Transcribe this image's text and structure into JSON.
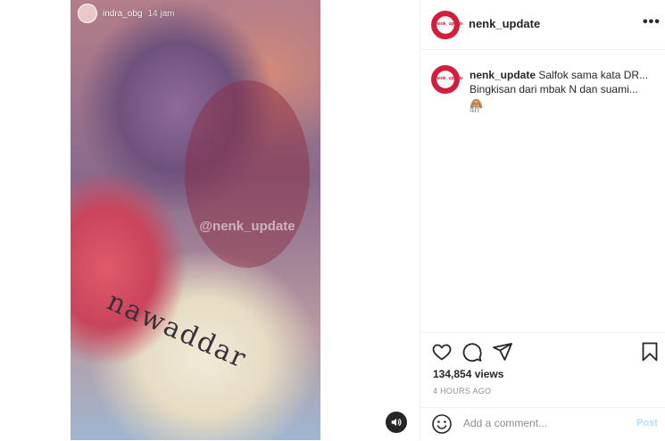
{
  "story": {
    "username": "indra_obg",
    "time": "14 jam",
    "watermark": "@nenk_update",
    "fruit_writing": "nawaddar"
  },
  "post": {
    "username": "nenk_update",
    "avatar_label": "nenk_update",
    "more_icon": "•••"
  },
  "caption": {
    "username": "nenk_update",
    "line1": "Salfok sama kata DR...",
    "line2": "Bingkisan dari mbak N dan suami... 🙈",
    "time": "4h"
  },
  "actions": {
    "views": "134,854 views",
    "posted": "4 HOURS AGO"
  },
  "comment": {
    "placeholder": "Add a comment...",
    "post_label": "Post"
  },
  "icons": {
    "like": "heart-icon",
    "comment": "comment-icon",
    "share": "share-icon",
    "save": "bookmark-icon",
    "emoji": "smiley-icon",
    "mute": "speaker-icon"
  }
}
